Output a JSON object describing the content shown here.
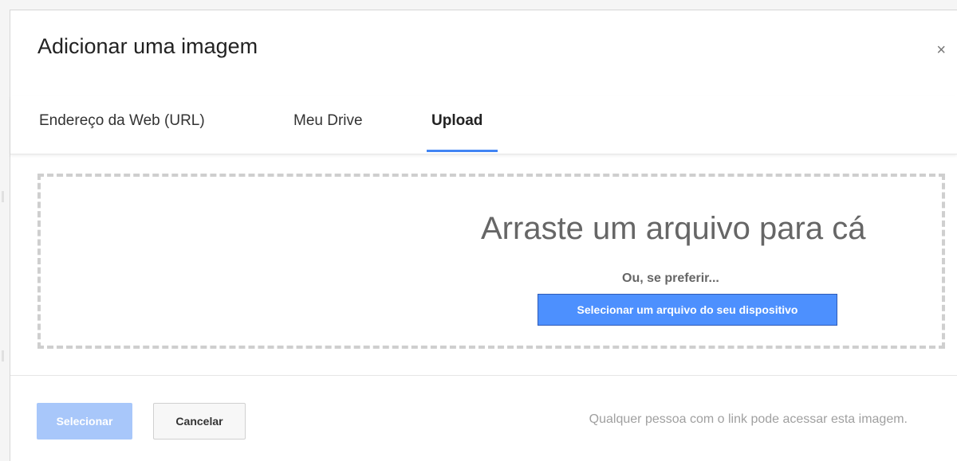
{
  "dialog": {
    "title": "Adicionar uma imagem",
    "close_symbol": "×"
  },
  "tabs": [
    {
      "label": "Endereço da Web (URL)",
      "active": false
    },
    {
      "label": "Meu Drive",
      "active": false
    },
    {
      "label": "Upload",
      "active": true
    }
  ],
  "dropzone": {
    "title": "Arraste um arquivo para cá",
    "or_text": "Ou, se preferir...",
    "select_button_label": "Selecionar um arquivo do seu dispositivo"
  },
  "footer": {
    "select_label": "Selecionar",
    "cancel_label": "Cancelar",
    "note": "Qualquer pessoa com o link pode acessar esta imagem."
  },
  "colors": {
    "accent": "#4285f4",
    "primary_button": "#4d90fe",
    "disabled_button": "#a8c7fa"
  }
}
